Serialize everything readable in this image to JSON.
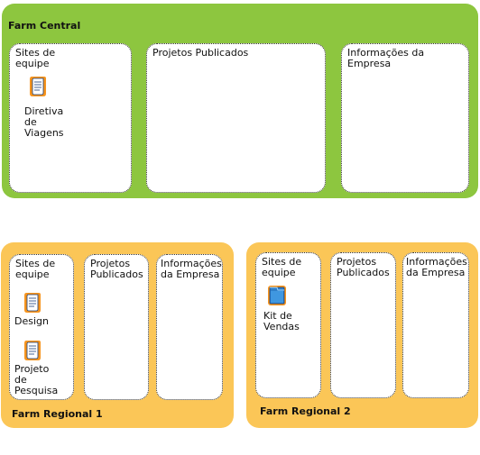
{
  "central": {
    "title": "Farm Central",
    "boxes": {
      "team_sites": "Sites de\nequipe",
      "published_projects": "Projetos Publicados",
      "company_info": "Informações da\nEmpresa"
    },
    "items": [
      {
        "label": "Diretiva de\nViagens",
        "icon": "document-scroll-icon"
      }
    ]
  },
  "regional1": {
    "title": "Farm Regional 1",
    "boxes": {
      "team_sites": "Sites de\nequipe",
      "published_projects": "Projetos\nPublicados",
      "company_info": "Informações\nda Empresa"
    },
    "items": [
      {
        "label": "Design",
        "icon": "document-scroll-icon"
      },
      {
        "label": "Projeto de\nPesquisa",
        "icon": "document-scroll-icon"
      }
    ]
  },
  "regional2": {
    "title": "Farm Regional 2",
    "boxes": {
      "team_sites": "Sites de\nequipe",
      "published_projects": "Projetos\nPublicados",
      "company_info": "Informações\nda Empresa"
    },
    "items": [
      {
        "label": "Kit de\nVendas",
        "icon": "folder-icon"
      }
    ]
  },
  "colors": {
    "central_bg": "#8dc63f",
    "regional_bg": "#fbc657",
    "icon_orange": "#f7941d",
    "folder_blue": "#2e7fc9"
  }
}
